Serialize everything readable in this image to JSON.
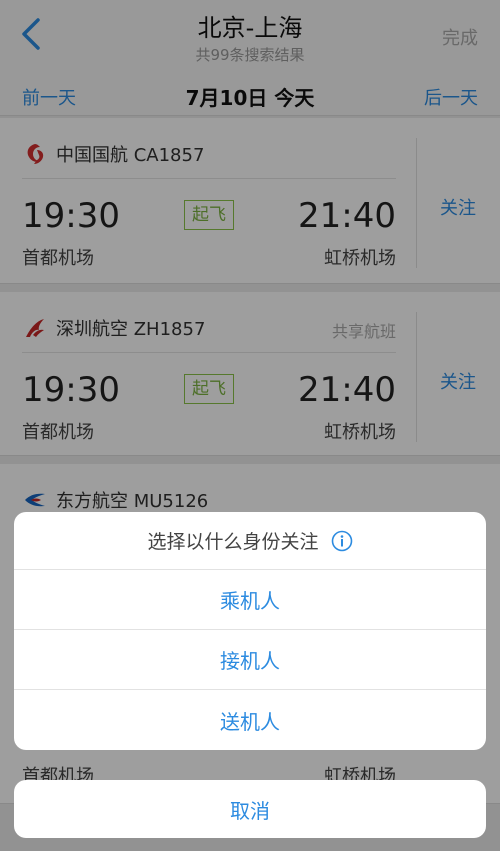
{
  "header": {
    "title": "北京-上海",
    "subtitle": "共99条搜索结果",
    "done_label": "完成"
  },
  "datebar": {
    "prev_label": "前一天",
    "current_date": "7月10日 今天",
    "next_label": "后一天"
  },
  "flights": [
    {
      "airline": "中国国航 CA1857",
      "logo": "air-china-logo",
      "share_tag": "",
      "dep_time": "19:30",
      "arr_time": "21:40",
      "status": "起飞",
      "dep_airport": "首都机场",
      "arr_airport": "虹桥机场",
      "follow_label": "关注"
    },
    {
      "airline": "深圳航空 ZH1857",
      "logo": "shenzhen-airlines-logo",
      "share_tag": "共享航班",
      "dep_time": "19:30",
      "arr_time": "21:40",
      "status": "起飞",
      "dep_airport": "首都机场",
      "arr_airport": "虹桥机场",
      "follow_label": "关注"
    },
    {
      "airline": "东方航空 MU5126",
      "logo": "china-eastern-logo",
      "dep_airport": "首都机场",
      "arr_airport": "虹桥机场"
    }
  ],
  "action_sheet": {
    "title": "选择以什么身份关注",
    "info_icon": "info-icon",
    "options": [
      "乘机人",
      "接机人",
      "送机人"
    ],
    "cancel_label": "取消"
  },
  "colors": {
    "accent": "#2c8be0",
    "status_green": "#7cb342",
    "overlay": "rgba(0,0,0,0.38)"
  }
}
